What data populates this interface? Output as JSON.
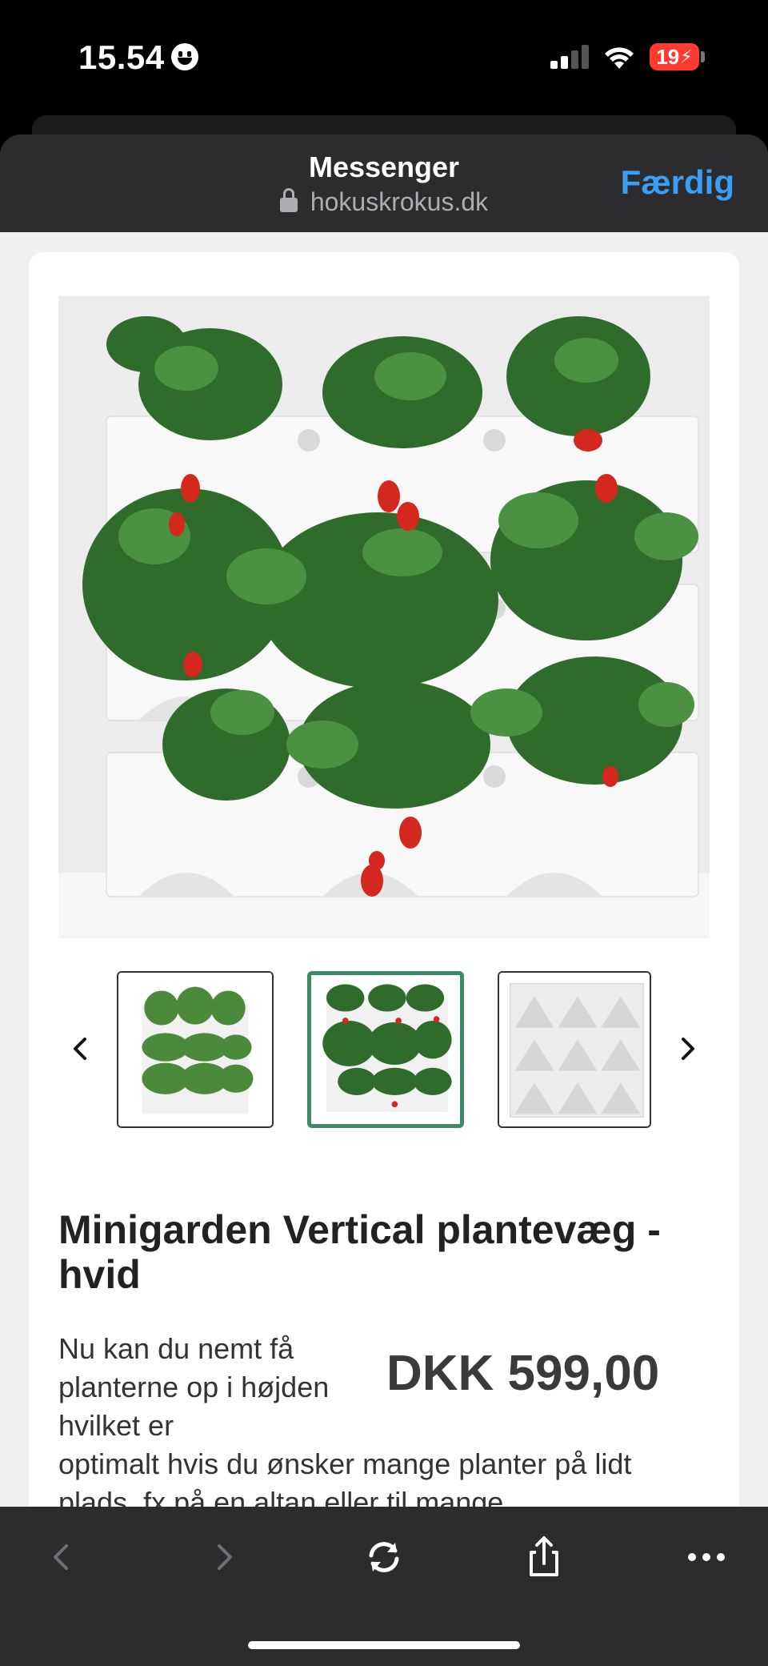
{
  "status_bar": {
    "time": "15.54",
    "battery": "19"
  },
  "browser": {
    "title": "Messenger",
    "url": "hokuskrokus.dk",
    "done_label": "Færdig"
  },
  "product": {
    "title": "Minigarden Vertical plantevæg - hvid",
    "price": "DKK 599,00",
    "description_part1": "Nu kan du nemt få planterne op i højden hvilket er",
    "description_part2": "optimalt hvis du ønsker mange planter på lidt plads, fx på en altan eller til mange"
  },
  "gallery": {
    "thumbnails": [
      {
        "name": "herbs",
        "active": false
      },
      {
        "name": "strawberries",
        "active": true
      },
      {
        "name": "empty-white",
        "active": false
      }
    ]
  },
  "colors": {
    "accent_blue": "#3a9ff5",
    "active_thumb": "#3d8b66",
    "battery_red": "#ff3b30"
  }
}
